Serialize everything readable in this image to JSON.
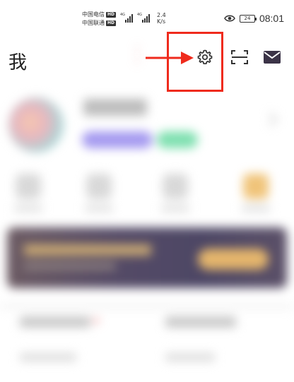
{
  "status_bar": {
    "carrier1": "中国电信",
    "carrier2": "中国联通",
    "hd": "HD",
    "network_type": "4G",
    "net_speed_value": "2.4",
    "net_speed_unit": "K/s",
    "battery": "24",
    "time": "08:01"
  },
  "header": {
    "title": "我"
  },
  "annotation": {
    "color": "#ef2b1d"
  },
  "icons": {
    "settings": "gear-icon",
    "scan": "scan-icon",
    "mail": "mail-icon",
    "eye": "eye-icon"
  }
}
